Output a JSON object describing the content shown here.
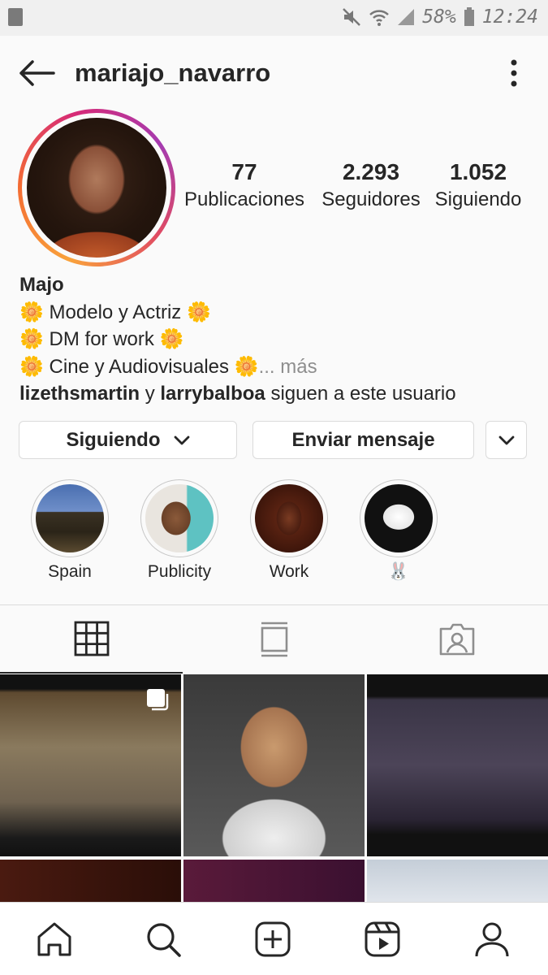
{
  "status_bar": {
    "battery": "58%",
    "time": "12:24"
  },
  "header": {
    "username": "mariajo_navarro"
  },
  "stats": [
    {
      "value": "77",
      "label": "Publicaciones"
    },
    {
      "value": "2.293",
      "label": "Seguidores"
    },
    {
      "value": "1.052",
      "label": "Siguiendo"
    }
  ],
  "bio": {
    "name": "Majo",
    "lines": [
      "🌼 Modelo y Actriz 🌼",
      "🌼 DM for work 🌼",
      "🌼 Cine y Audiovisuales 🌼"
    ],
    "more": "... más",
    "followed_by": {
      "user1": "lizethsmartin",
      "connector": "y",
      "user2": "larrybalboa",
      "suffix": "siguen a este usuario"
    }
  },
  "buttons": {
    "following": "Siguiendo",
    "message": "Enviar mensaje"
  },
  "highlights": [
    {
      "label": "Spain"
    },
    {
      "label": "Publicity"
    },
    {
      "label": "Work"
    },
    {
      "label": "🐰"
    }
  ],
  "colors": {
    "accent_text": "#262626",
    "secondary_text": "#8e8e8e",
    "border": "#dbdbdb"
  },
  "icons": {
    "tabs": [
      "grid-icon",
      "feed-icon",
      "tagged-icon"
    ],
    "nav": [
      "home-icon",
      "search-icon",
      "add-icon",
      "reels-icon",
      "profile-icon"
    ]
  }
}
